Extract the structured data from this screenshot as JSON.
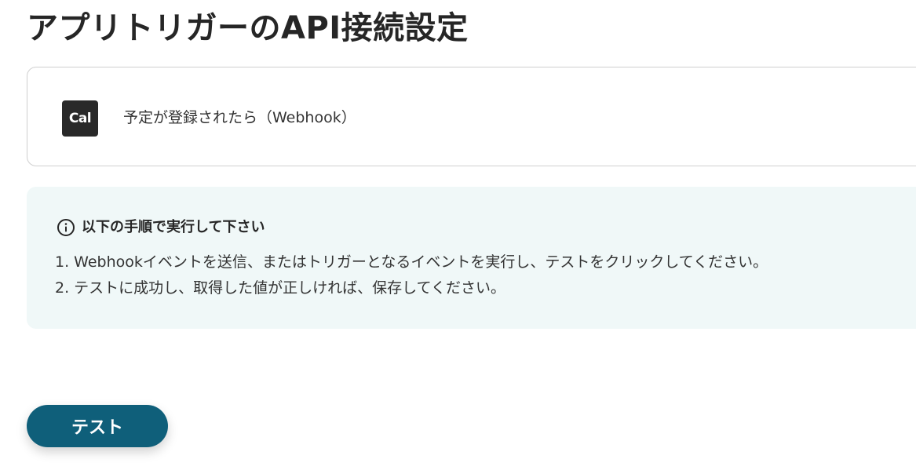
{
  "page": {
    "title": "アプリトリガーのAPI接続設定"
  },
  "trigger": {
    "app_logo_text": "Cal",
    "name": "予定が登録されたら（Webhook）"
  },
  "instructions": {
    "heading": "以下の手順で実行して下さい",
    "icon": "info-icon",
    "steps": [
      "1. Webhookイベントを送信、またはトリガーとなるイベントを実行し、テストをクリックしてください。",
      "2. テストに成功し、取得した値が正しければ、保存してください。"
    ]
  },
  "actions": {
    "test_label": "テスト"
  },
  "colors": {
    "primary_button": "#0f5f7a",
    "panel_background": "#f0f8f8",
    "logo_background": "#292929"
  }
}
